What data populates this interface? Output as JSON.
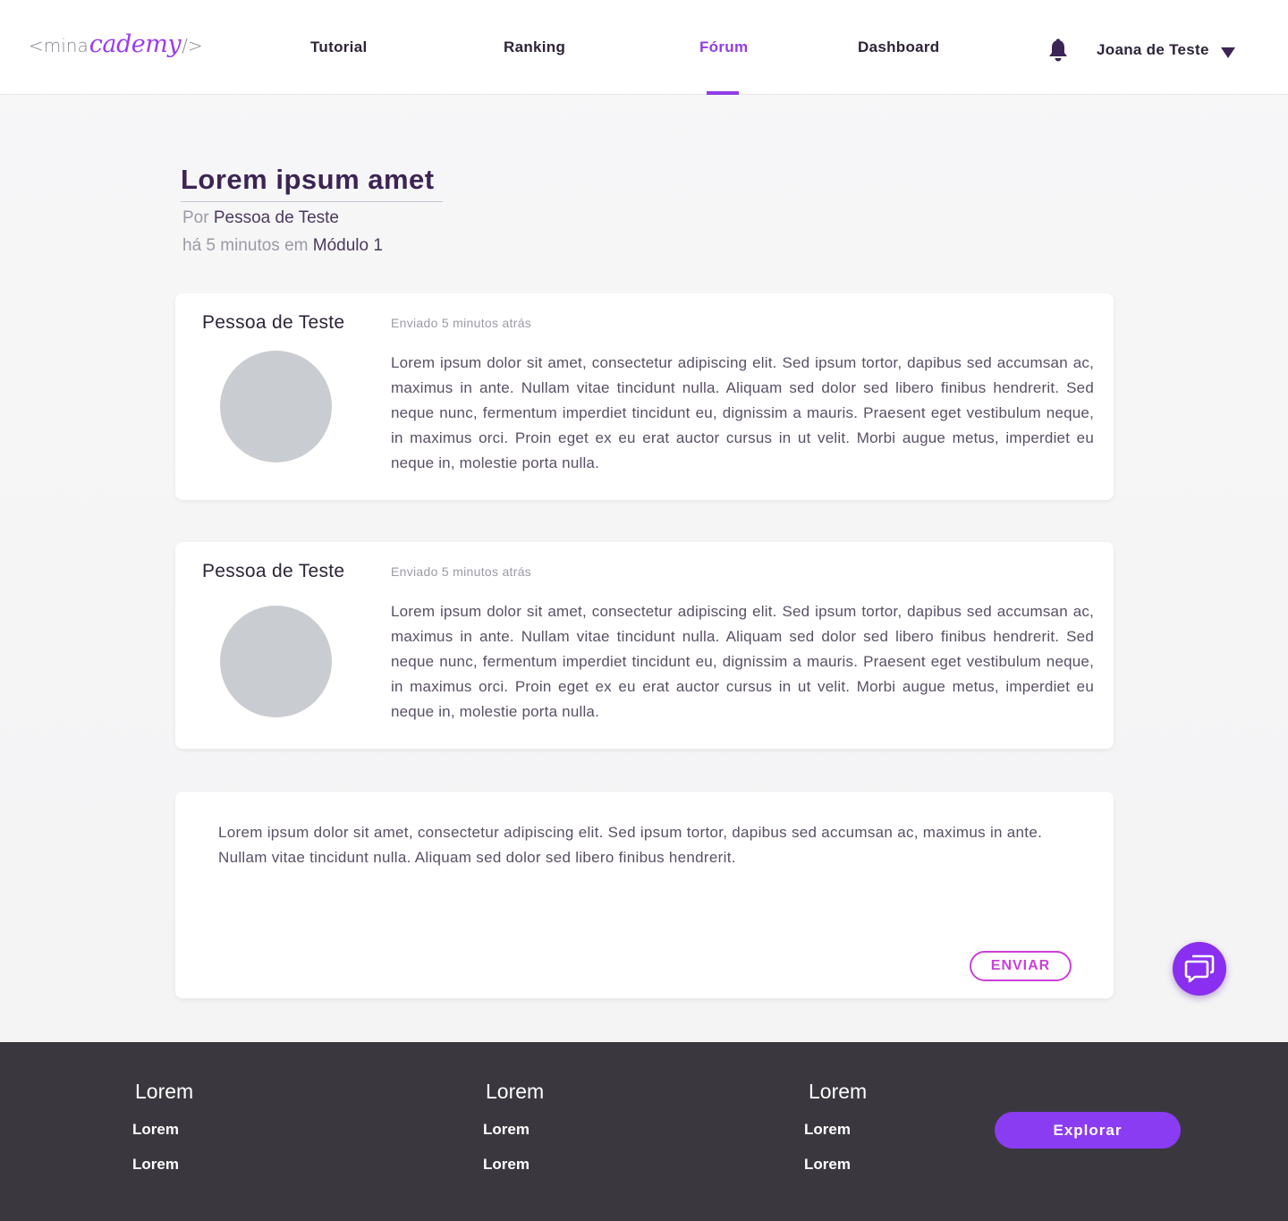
{
  "header": {
    "logo": {
      "open": "<mina",
      "brand": "cademy",
      "close": "/>"
    },
    "nav": [
      {
        "label": "Tutorial"
      },
      {
        "label": "Ranking"
      },
      {
        "label": "Fórum",
        "active": true
      },
      {
        "label": "Dashboard"
      }
    ],
    "notifications_icon": "bell-icon",
    "user": {
      "name": "Joana de Teste",
      "caret_icon": "caret-down-icon"
    }
  },
  "topic": {
    "title": "Lorem ipsum amet",
    "by_prefix": "Por",
    "author": "Pessoa de Teste",
    "time_prefix": "há 5 minutos em",
    "module": "Módulo 1"
  },
  "posts": [
    {
      "author": "Pessoa de Teste",
      "sent": "Enviado 5 minutos atrás",
      "body": "Lorem ipsum dolor sit amet, consectetur adipiscing elit. Sed ipsum tortor, dapibus sed accumsan ac, maximus in ante. Nullam vitae tincidunt nulla. Aliquam sed dolor sed libero finibus hendrerit. Sed neque nunc, fermentum imperdiet tincidunt eu, dignissim a mauris. Praesent eget vestibulum neque, in maximus orci. Proin eget ex eu erat auctor cursus in ut velit. Morbi augue metus, imperdiet eu neque in, molestie porta nulla."
    },
    {
      "author": "Pessoa de Teste",
      "sent": "Enviado 5 minutos atrás",
      "body": "Lorem ipsum dolor sit amet, consectetur adipiscing elit. Sed ipsum tortor, dapibus sed accumsan ac, maximus in ante. Nullam vitae tincidunt nulla. Aliquam sed dolor sed libero finibus hendrerit. Sed neque nunc, fermentum imperdiet tincidunt eu, dignissim a mauris. Praesent eget vestibulum neque, in maximus orci. Proin eget ex eu erat auctor cursus in ut velit. Morbi augue metus, imperdiet eu neque in, molestie porta nulla."
    }
  ],
  "reply": {
    "value": "Lorem ipsum dolor sit amet, consectetur adipiscing elit. Sed ipsum tortor, dapibus sed accumsan ac, maximus in ante. Nullam vitae tincidunt nulla. Aliquam sed dolor sed libero finibus hendrerit.",
    "send_label": "ENVIAR"
  },
  "chat_icon": "chat-bubbles-icon",
  "footer": {
    "columns": [
      {
        "heading": "Lorem",
        "links": [
          "Lorem",
          "Lorem"
        ]
      },
      {
        "heading": "Lorem",
        "links": [
          "Lorem",
          "Lorem"
        ]
      },
      {
        "heading": "Lorem",
        "links": [
          "Lorem",
          "Lorem"
        ]
      }
    ],
    "explore_label": "Explorar"
  },
  "colors": {
    "accent": "#8f3de6",
    "send_outline": "#cc3fd9",
    "footer_bg": "#3a383e",
    "text_dark": "#2e2438"
  }
}
